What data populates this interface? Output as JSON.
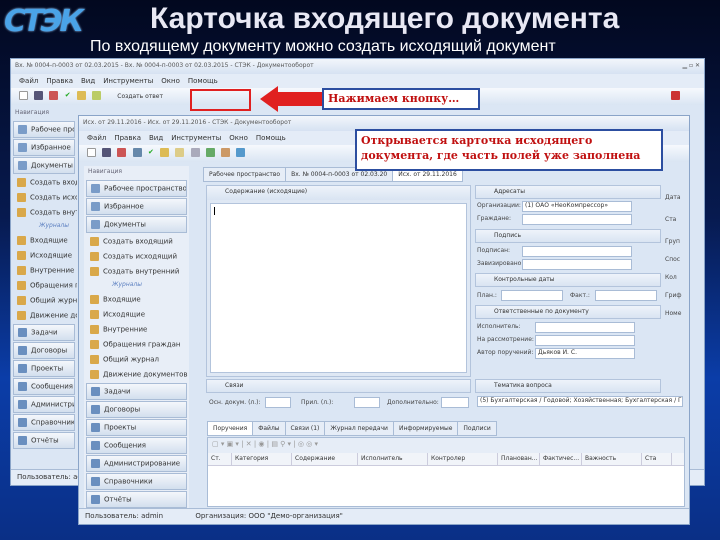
{
  "slide": {
    "logo_text": "СТЭК",
    "title": "Карточка входящего документа",
    "subtitle": "По входящему документу можно создать исходящий документ"
  },
  "callouts": {
    "first": "Нажимаем кнопку…",
    "second": "Открывается карточка исходящего документа, где часть полей уже заполнена"
  },
  "back_window": {
    "title": "Вх. № 0004-п-0003 от 02.03.2015 - Вх. № 0004-п-0003 от 02.03.2015 - СТЭК - Документооборот",
    "menu": [
      "Файл",
      "Правка",
      "Вид",
      "Инструменты",
      "Окно",
      "Помощь"
    ],
    "create_reply_label": "Создать ответ",
    "nav_header": "Навигация",
    "nav_groups": [
      "Рабочее пространство",
      "Избранное",
      "Документы"
    ],
    "nav_items": [
      "Создать входящий",
      "Создать исходящий",
      "Создать внутренний"
    ],
    "nav_section": "Журналы",
    "nav_journals": [
      "Входящие",
      "Исходящие",
      "Внутренние",
      "Обращения граждан",
      "Общий журнал",
      "Движение документов"
    ],
    "nav_groups2": [
      "Задачи",
      "Договоры",
      "Проекты",
      "Сообщения",
      "Администрирование",
      "Справочники",
      "Отчёты"
    ],
    "status_user": "Пользователь: admin"
  },
  "front_window": {
    "title": "Исх. от 29.11.2016 - Исх. от 29.11.2016 - СТЭК - Документооборот",
    "menu": [
      "Файл",
      "Правка",
      "Вид",
      "Инструменты",
      "Окно",
      "Помощь"
    ],
    "nav_header": "Навигация",
    "nav_groups": [
      "Рабочее пространство",
      "Избранное",
      "Документы"
    ],
    "nav_items": [
      "Создать входящий",
      "Создать исходящий",
      "Создать внутренний"
    ],
    "nav_section": "Журналы",
    "nav_journals": [
      "Входящие",
      "Исходящие",
      "Внутренние",
      "Обращения граждан",
      "Общий журнал",
      "Движение документов"
    ],
    "nav_groups2": [
      "Задачи",
      "Договоры",
      "Проекты",
      "Сообщения",
      "Администрирование",
      "Справочники",
      "Отчёты"
    ],
    "doc_tabs": [
      "Рабочее пространство",
      "Вх. № 0004-п-0003 от 02.03.20",
      "Исх. от 29.11.2016"
    ],
    "content_label": "Содержание (исходящие)",
    "addressees": {
      "title": "Адресаты",
      "org_label": "Организации:",
      "org_value": "(1) ОАО «НеоКомпрессор»",
      "citizens_label": "Граждане:"
    },
    "signature": {
      "title": "Подпись",
      "signed_label": "Подписан:",
      "approved_label": "Завизировано:"
    },
    "control": {
      "title": "Контрольные даты",
      "plan_label": "План.:",
      "fact_label": "Факт.:"
    },
    "responsible": {
      "title": "Ответственные по документу",
      "executor_label": "Исполнитель:",
      "review_label": "На рассмотрение:",
      "author_label": "Автор поручений:",
      "author_value": "Дьяков И. С."
    },
    "topics": {
      "title": "Тематика вопроса",
      "value": "(5) Бухгалтерская / Годовой; Хозяйственная; Бухгалтерская / Годовой"
    },
    "right_col": [
      "Дата",
      "Ста",
      "Груп",
      "Спос",
      "Кол",
      "Гриф",
      "Номе"
    ],
    "links_label": "Связи",
    "main_doc_label": "Осн. докум. (л.):",
    "attach_label": "Прил. (л.):",
    "extra_label": "Дополнительно:",
    "bottom_tabs": [
      "Поручения",
      "Файлы",
      "Связи (1)",
      "Журнал передачи",
      "Информируемые",
      "Подписи"
    ],
    "grid_columns": [
      "Ст.",
      "Категория",
      "Содержание",
      "Исполнитель",
      "Контролер",
      "Планован...",
      "Фактичес...",
      "Важность",
      "Ста"
    ],
    "status_user": "Пользователь: admin",
    "status_org": "Организация: ООО \"Демо-организация\""
  },
  "colors": {
    "accent_red": "#e02020",
    "callout_text": "#c01010",
    "callout_border": "#2c4ea0"
  }
}
